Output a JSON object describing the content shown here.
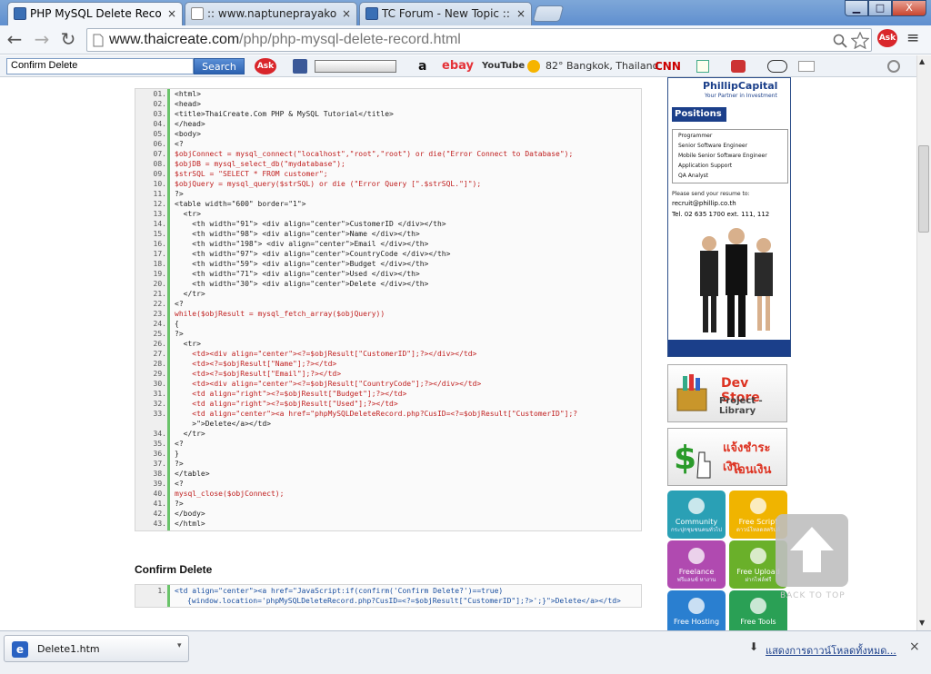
{
  "tabs": [
    {
      "title": "PHP MySQL Delete Record/C",
      "close": "×"
    },
    {
      "title": ":: www.naptuneprayakorn.c",
      "close": "×"
    },
    {
      "title": "TC Forum - New Topic :: เริ่ม",
      "close": "×"
    }
  ],
  "window_controls": {
    "minimize": "▁",
    "maximize": "□",
    "close": "X"
  },
  "nav": {
    "back": "←",
    "forward": "→",
    "reload": "↻",
    "url_host": "www.thaicreate.com",
    "url_path": "/php/php-mysql-delete-record.html",
    "menu": "≡",
    "ask": "Ask"
  },
  "toolbar": {
    "search_value": "Confirm Delete",
    "search_button": "Search",
    "ask": "Ask",
    "amazon": "a",
    "ebay": "ebay",
    "youtube": "YouTube",
    "weather": "82° Bangkok, Thailand",
    "cnn": "CNN"
  },
  "code": {
    "lines": [
      "<html>",
      "<head>",
      "<title>ThaiCreate.Com PHP & MySQL Tutorial</title>",
      "</head>",
      "<body>",
      "<?",
      "$objConnect = mysql_connect(\"localhost\",\"root\",\"root\") or die(\"Error Connect to Database\");",
      "$objDB = mysql_select_db(\"mydatabase\");",
      "$strSQL = \"SELECT * FROM customer\";",
      "$objQuery = mysql_query($strSQL) or die (\"Error Query [\".$strSQL.\"]\");",
      "?>",
      "<table width=\"600\" border=\"1\">",
      "  <tr>",
      "    <th width=\"91\"> <div align=\"center\">CustomerID </div></th>",
      "    <th width=\"98\"> <div align=\"center\">Name </div></th>",
      "    <th width=\"198\"> <div align=\"center\">Email </div></th>",
      "    <th width=\"97\"> <div align=\"center\">CountryCode </div></th>",
      "    <th width=\"59\"> <div align=\"center\">Budget </div></th>",
      "    <th width=\"71\"> <div align=\"center\">Used </div></th>",
      "    <th width=\"30\"> <div align=\"center\">Delete </div></th>",
      "  </tr>",
      "<?",
      "while($objResult = mysql_fetch_array($objQuery))",
      "{",
      "?>",
      "  <tr>",
      "    <td><div align=\"center\"><?=$objResult[\"CustomerID\"];?></div></td>",
      "    <td><?=$objResult[\"Name\"];?></td>",
      "    <td><?=$objResult[\"Email\"];?></td>",
      "    <td><div align=\"center\"><?=$objResult[\"CountryCode\"];?></div></td>",
      "    <td align=\"right\"><?=$objResult[\"Budget\"];?></td>",
      "    <td align=\"right\"><?=$objResult[\"Used\"];?></td>",
      "    <td align=\"center\"><a href=\"phpMySQLDeleteRecord.php?CusID=<?=$objResult[\"CustomerID\"];?",
      "    >\">Delete</a></td>",
      "  </tr>",
      "<?",
      "}",
      "?>",
      "</table>",
      "<?",
      "mysql_close($objConnect);",
      "?>",
      "</body>",
      "</html>"
    ],
    "numbers": [
      "01.",
      "02.",
      "03.",
      "04.",
      "05.",
      "06.",
      "07.",
      "08.",
      "09.",
      "10.",
      "11.",
      "12.",
      "13.",
      "14.",
      "15.",
      "16.",
      "17.",
      "18.",
      "19.",
      "20.",
      "21.",
      "22.",
      "23.",
      "24.",
      "25.",
      "26.",
      "27.",
      "28.",
      "29.",
      "30.",
      "31.",
      "32.",
      "33.",
      "",
      "34.",
      "35.",
      "36.",
      "37.",
      "38.",
      "39.",
      "40.",
      "41.",
      "42.",
      "43."
    ]
  },
  "confirm_heading": "Confirm Delete",
  "code2": {
    "number": "1.",
    "line1": "<td align=\"center\"><a href=\"JavaScript:if(confirm('Confirm Delete?')==true)",
    "line2": "{window.location='phpMySQLDeleteRecord.php?CusID=<?=$objResult[\"CustomerID\"];?>';}\">Delete</a></td>"
  },
  "ad_phillip": {
    "logo": "PhillipCapital",
    "tagline": "Your Partner in Investment",
    "positions": "Positions",
    "items": [
      "Programmer",
      "Senior Software Engineer",
      "Mobile Senior Software Engineer",
      "Application Support",
      "QA Analyst"
    ],
    "send": "Please send your resume to:",
    "email": "recruit@phillip.co.th",
    "tel": "Tel. 02 635 1700 ext. 111, 112"
  },
  "ad_dev": {
    "title": "Dev Store",
    "sub": "Project - Library"
  },
  "ad_pay": {
    "title": "แจ้งชำระเงิน",
    "sub": "โอนเงิน"
  },
  "tiles": [
    {
      "title": "Community",
      "sub": "กระปุกชุมชนคนทั่วไป",
      "color": "#2aa0b5"
    },
    {
      "title": "Free Script",
      "sub": "ดาวน์โหลดสคริปต์",
      "color": "#f0b400"
    },
    {
      "title": "Freelance",
      "sub": "ฟรีแลนซ์ หางาน",
      "color": "#b04ab0"
    },
    {
      "title": "Free Upload",
      "sub": "ฝากไฟล์ฟรี",
      "color": "#6ab02a"
    },
    {
      "title": "Free Hosting",
      "sub": "",
      "color": "#2a7fd0"
    },
    {
      "title": "Free Tools",
      "sub": "",
      "color": "#2aa055"
    }
  ],
  "back_to_top": "BACK TO TOP",
  "downloads": {
    "file": "Delete1.htm",
    "show_all": "แสดงการดาวน์โหลดทั้งหมด...",
    "close": "×"
  }
}
